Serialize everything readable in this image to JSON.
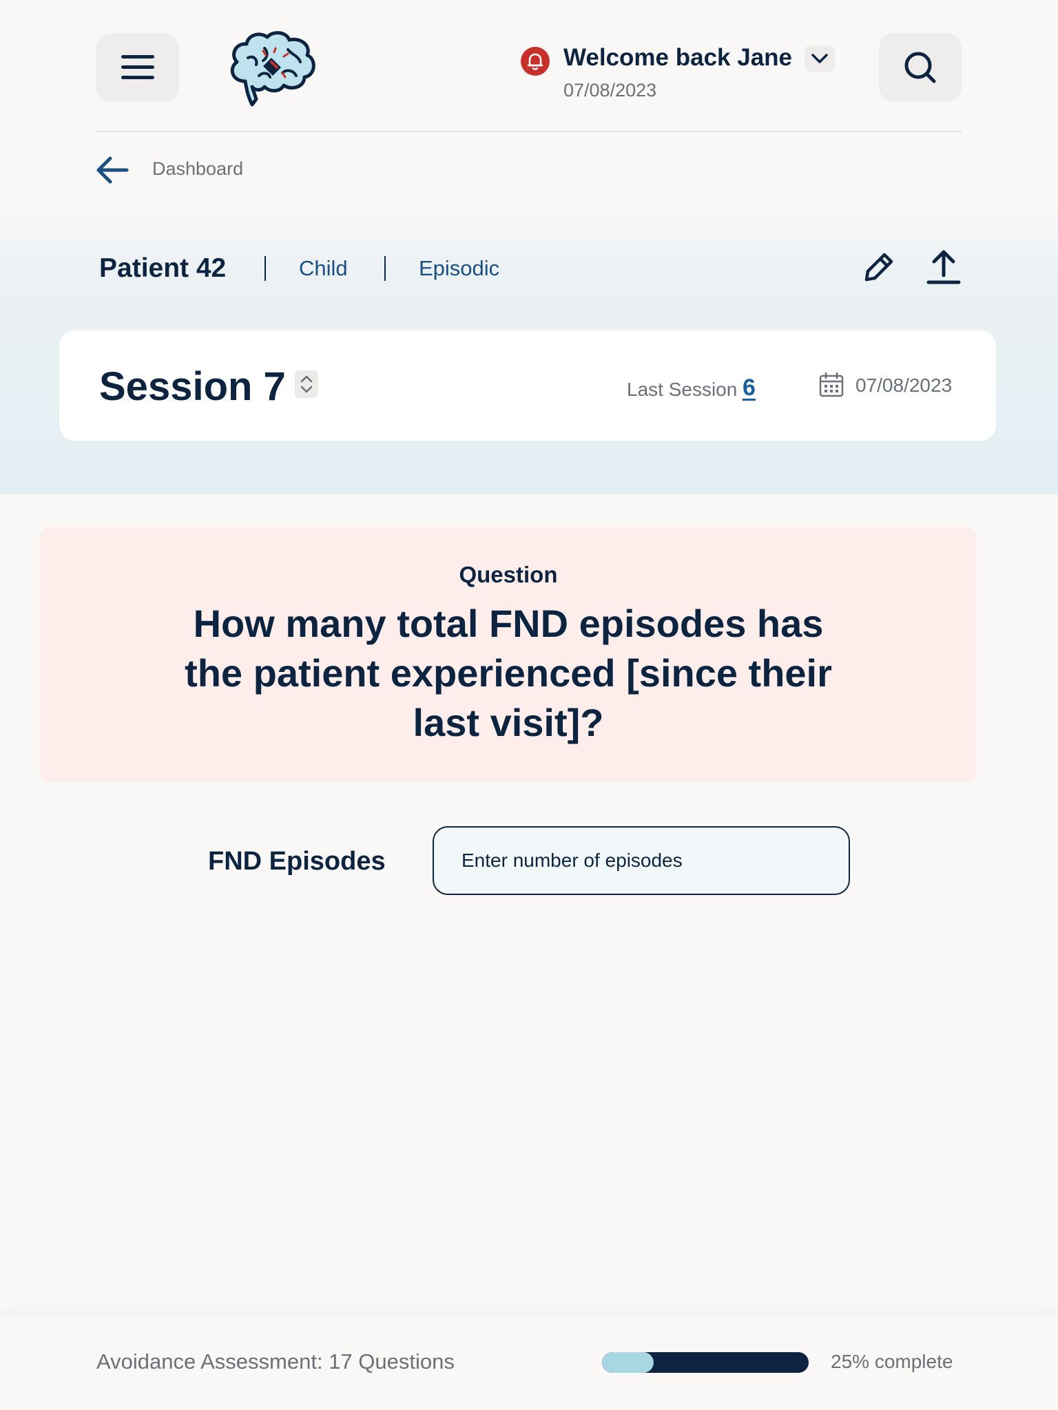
{
  "header": {
    "menu_icon": "hamburger-menu-icon",
    "logo_icon": "brain-logo-icon",
    "notification_icon": "bell-icon",
    "welcome_text": "Welcome back Jane",
    "welcome_date": "07/08/2023",
    "dropdown_icon": "chevron-down-icon",
    "search_icon": "search-icon"
  },
  "breadcrumb": {
    "back_icon": "arrow-left-icon",
    "label": "Dashboard"
  },
  "patient": {
    "name": "Patient 42",
    "tags": [
      "Child",
      "Episodic"
    ],
    "edit_icon": "pencil-icon",
    "export_icon": "upload-icon"
  },
  "session": {
    "title": "Session 7",
    "stepper_icon": "up-down-chevron-icon",
    "last_session_label": "Last Session",
    "last_session_number": "6",
    "calendar_icon": "calendar-icon",
    "date": "07/08/2023"
  },
  "question": {
    "label": "Question",
    "text": "How many total FND episodes has the patient experienced [since their last visit]?"
  },
  "answer": {
    "label": "FND Episodes",
    "placeholder": "Enter number of episodes",
    "value": ""
  },
  "footer": {
    "assessment_text": "Avoidance Assessment: 17 Questions",
    "progress_fraction": 0.25,
    "progress_text": "25% complete"
  },
  "colors": {
    "navy": "#0c2440",
    "link_blue": "#1a4f82",
    "alert_red": "#c8302c",
    "question_bg": "#fdeeeb",
    "progress_fill": "#a8d6e2"
  }
}
